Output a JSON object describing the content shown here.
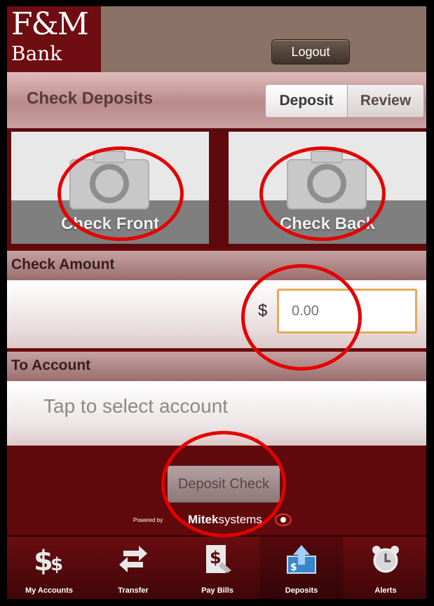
{
  "header": {
    "logo_main": "F&M",
    "logo_bank": "Bank",
    "logout_label": "Logout"
  },
  "titlebar": {
    "title": "Check Deposits",
    "tabs": [
      "Deposit",
      "Review"
    ],
    "selected_tab": "Deposit"
  },
  "capture": {
    "front_label": "Check Front",
    "back_label": "Check Back"
  },
  "amount": {
    "section_label": "Check Amount",
    "currency_symbol": "$",
    "placeholder": "0.00"
  },
  "account": {
    "section_label": "To Account",
    "prompt": "Tap to select account"
  },
  "deposit_button_label": "Deposit Check",
  "powered_by": {
    "prefix": "Powered by",
    "brand_bold": "Mitek",
    "brand_rest": "systems"
  },
  "tabbar": {
    "items": [
      {
        "label": "My Accounts",
        "icon": "dollar-icon"
      },
      {
        "label": "Transfer",
        "icon": "transfer-arrows-icon"
      },
      {
        "label": "Pay Bills",
        "icon": "bill-icon"
      },
      {
        "label": "Deposits",
        "icon": "deposit-upload-icon"
      },
      {
        "label": "Alerts",
        "icon": "alarm-clock-icon"
      }
    ],
    "active": "Deposits"
  },
  "colors": {
    "brand_maroon": "#6b0a0e",
    "header_taupe": "#8a7266",
    "annotation_red": "#e30000",
    "input_focus_orange": "#e9a95a"
  }
}
